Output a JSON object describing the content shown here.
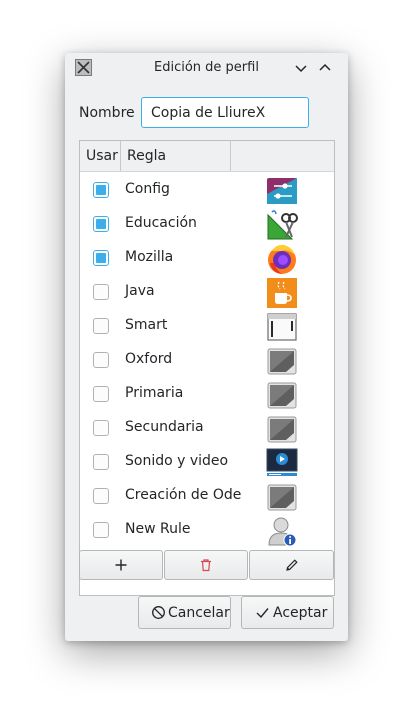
{
  "window": {
    "title": "Edición de perfil"
  },
  "form": {
    "name_label": "Nombre",
    "name_value": "Copia de LliureX"
  },
  "table": {
    "headers": {
      "use": "Usar",
      "rule": "Regla"
    },
    "rows": [
      {
        "name": "Config",
        "checked": true,
        "icon": "settings-sliders-icon"
      },
      {
        "name": "Educación",
        "checked": true,
        "icon": "education-tools-icon"
      },
      {
        "name": "Mozilla",
        "checked": true,
        "icon": "firefox-icon"
      },
      {
        "name": "Java",
        "checked": false,
        "icon": "java-cup-icon"
      },
      {
        "name": "Smart",
        "checked": false,
        "icon": "smart-window-icon"
      },
      {
        "name": "Oxford",
        "checked": false,
        "icon": "generic-app-icon"
      },
      {
        "name": "Primaria",
        "checked": false,
        "icon": "generic-app-icon"
      },
      {
        "name": "Secundaria",
        "checked": false,
        "icon": "generic-app-icon"
      },
      {
        "name": "Sonido y video",
        "checked": false,
        "icon": "media-player-icon"
      },
      {
        "name": "Creación de Ode",
        "checked": false,
        "icon": "generic-app-icon"
      },
      {
        "name": "New Rule",
        "checked": false,
        "icon": "user-info-icon"
      }
    ]
  },
  "toolbar": {
    "add_icon": "plus-icon",
    "delete_icon": "trash-icon",
    "edit_icon": "pencil-icon"
  },
  "buttons": {
    "cancel": "Cancelar",
    "accept": "Aceptar"
  },
  "colors": {
    "accent": "#3daee9",
    "delete": "#da4453",
    "window_bg": "#eff0f1"
  }
}
